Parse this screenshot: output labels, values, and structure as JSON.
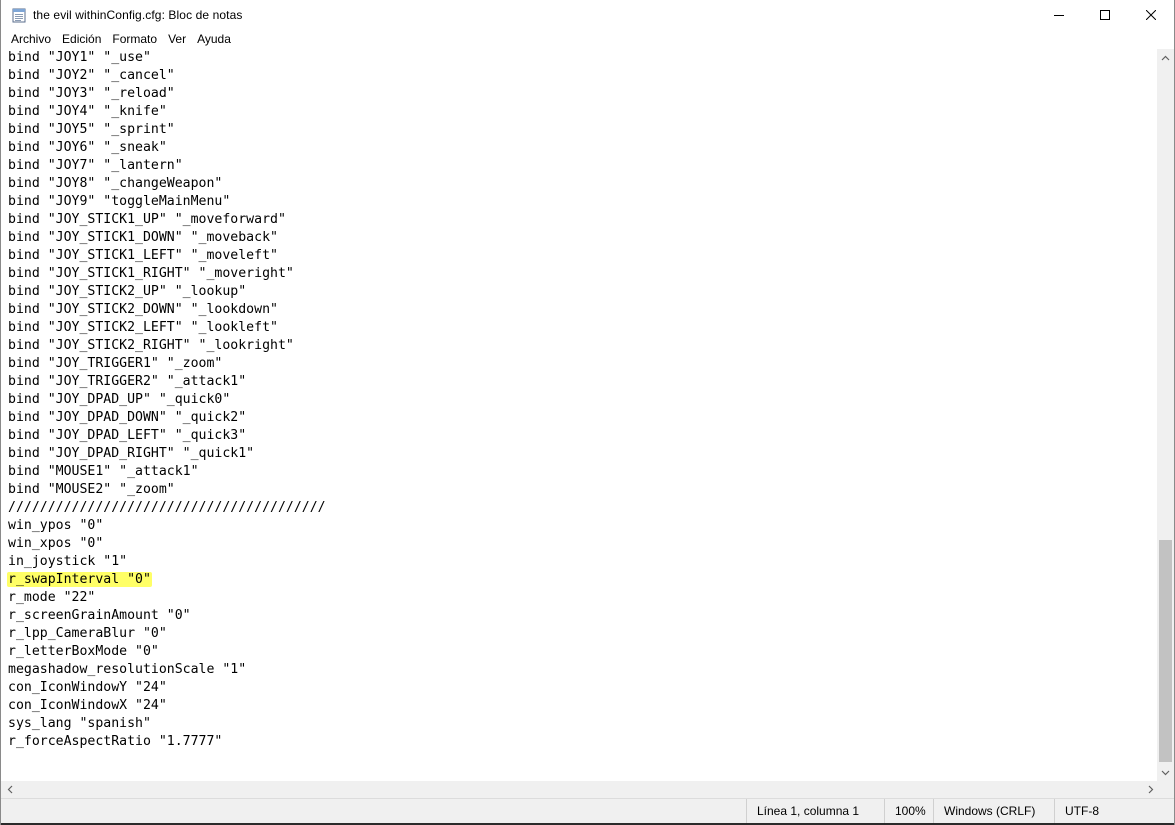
{
  "window": {
    "title": "the evil withinConfig.cfg: Bloc de notas",
    "icons": {
      "app": "notepad-icon",
      "minimize": "minimize-icon",
      "maximize": "maximize-icon",
      "close": "close-icon"
    }
  },
  "menu": {
    "items": [
      "Archivo",
      "Edición",
      "Formato",
      "Ver",
      "Ayuda"
    ]
  },
  "editor": {
    "highlighted_line_index": 29,
    "highlight_color": "#ffff66",
    "lines": [
      "bind \"JOY1\" \"_use\"",
      "bind \"JOY2\" \"_cancel\"",
      "bind \"JOY3\" \"_reload\"",
      "bind \"JOY4\" \"_knife\"",
      "bind \"JOY5\" \"_sprint\"",
      "bind \"JOY6\" \"_sneak\"",
      "bind \"JOY7\" \"_lantern\"",
      "bind \"JOY8\" \"_changeWeapon\"",
      "bind \"JOY9\" \"toggleMainMenu\"",
      "bind \"JOY_STICK1_UP\" \"_moveforward\"",
      "bind \"JOY_STICK1_DOWN\" \"_moveback\"",
      "bind \"JOY_STICK1_LEFT\" \"_moveleft\"",
      "bind \"JOY_STICK1_RIGHT\" \"_moveright\"",
      "bind \"JOY_STICK2_UP\" \"_lookup\"",
      "bind \"JOY_STICK2_DOWN\" \"_lookdown\"",
      "bind \"JOY_STICK2_LEFT\" \"_lookleft\"",
      "bind \"JOY_STICK2_RIGHT\" \"_lookright\"",
      "bind \"JOY_TRIGGER1\" \"_zoom\"",
      "bind \"JOY_TRIGGER2\" \"_attack1\"",
      "bind \"JOY_DPAD_UP\" \"_quick0\"",
      "bind \"JOY_DPAD_DOWN\" \"_quick2\"",
      "bind \"JOY_DPAD_LEFT\" \"_quick3\"",
      "bind \"JOY_DPAD_RIGHT\" \"_quick1\"",
      "bind \"MOUSE1\" \"_attack1\"",
      "bind \"MOUSE2\" \"_zoom\"",
      "////////////////////////////////////////",
      "win_ypos \"0\"",
      "win_xpos \"0\"",
      "in_joystick \"1\"",
      "r_swapInterval \"0\"",
      "r_mode \"22\"",
      "r_screenGrainAmount \"0\"",
      "r_lpp_CameraBlur \"0\"",
      "r_letterBoxMode \"0\"",
      "megashadow_resolutionScale \"1\"",
      "con_IconWindowY \"24\"",
      "con_IconWindowX \"24\"",
      "sys_lang \"spanish\"",
      "r_forceAspectRatio \"1.7777\""
    ]
  },
  "scrollbars": {
    "vertical_position": 0.92,
    "icons": {
      "up": "scroll-up-arrow-icon",
      "down": "scroll-down-arrow-icon",
      "left": "scroll-left-arrow-icon",
      "right": "scroll-right-arrow-icon"
    }
  },
  "status": {
    "position": "Línea 1, columna 1",
    "zoom": "100%",
    "line_ending": "Windows (CRLF)",
    "encoding": "UTF-8"
  }
}
